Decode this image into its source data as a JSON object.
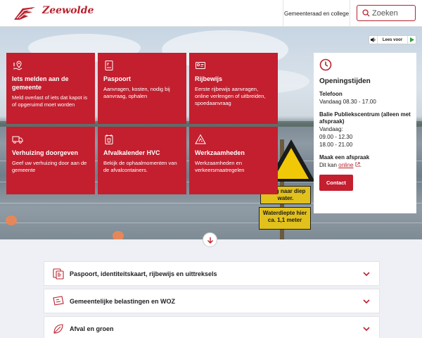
{
  "header": {
    "logo_text": "Zeewolde",
    "council_link": "Gemeenteraad en college",
    "search_placeholder": "Zoeken"
  },
  "read_aloud": {
    "label": "Lees voor"
  },
  "tiles": [
    {
      "title": "Iets melden aan de gemeente",
      "desc": "Meld overlast of iets dat kapot is of opgeruimd moet worden",
      "icon": "location-pin-icon"
    },
    {
      "title": "Paspoort",
      "desc": "Aanvragen, kosten, nodig bij aanvraag, ophalen",
      "icon": "passport-icon"
    },
    {
      "title": "Rijbewijs",
      "desc": "Eerste rijbewijs aanvragen, online verlengen of uitbreiden, spoedaanvraag",
      "icon": "id-card-icon"
    },
    {
      "title": "Verhuizing doorgeven",
      "desc": "Geef uw verhuizing door aan de gemeente",
      "icon": "moving-truck-icon"
    },
    {
      "title": "Afvalkalender HVC",
      "desc": "Bekijk de ophaalmomenten van de afvalcontainers.",
      "icon": "trash-calendar-icon"
    },
    {
      "title": "Werkzaamheden",
      "desc": "Werkzaamheden en verkeersmaatregelen",
      "icon": "roadwork-icon"
    }
  ],
  "hours": {
    "title": "Openingstijden",
    "phone_label": "Telefoon",
    "phone_line": "Vandaag 08.30 - 17.00",
    "desk_label": "Balie Publiekscentrum (alleen met afspraak)",
    "desk_today": "Vandaag:",
    "desk_slot1": "09.00 - 12.30",
    "desk_slot2": "18.00 - 21.00",
    "appt_label": "Maak een afspraak",
    "appt_prefix": "Dit kan ",
    "appt_link": "online",
    "appt_suffix": ".",
    "contact_button": "Contact"
  },
  "hero_sign": {
    "plate1": "gang naar diep water.",
    "plate2": "Waterdiepte hier ca. 1,1 meter"
  },
  "accordion": [
    {
      "label": "Paspoort, identiteitskaart, rijbewijs en uittreksels",
      "icon": "documents-icon"
    },
    {
      "label": "Gemeentelijke belastingen en WOZ",
      "icon": "tax-icon"
    },
    {
      "label": "Afval en groen",
      "icon": "leaf-icon"
    }
  ],
  "colors": {
    "brand_red": "#c31f2f",
    "header_red": "#b8222e",
    "page_bg": "#eef0f5"
  }
}
